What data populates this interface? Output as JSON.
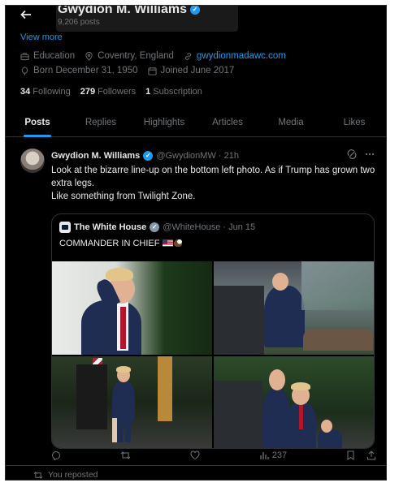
{
  "header": {
    "name": "Gwydion M. Williams",
    "posts_count": "9,206 posts",
    "view_more": "View more"
  },
  "profile_meta": {
    "category": "Education",
    "location": "Coventry, England",
    "website": "gwydionmadawc.com",
    "born": "Born December 31, 1950",
    "joined": "Joined June 2017"
  },
  "stats": {
    "following_count": "34",
    "following_label": "Following",
    "followers_count": "279",
    "followers_label": "Followers",
    "subscription_count": "1",
    "subscription_label": "Subscription"
  },
  "tabs": [
    {
      "label": "Posts",
      "active": true
    },
    {
      "label": "Replies",
      "active": false
    },
    {
      "label": "Highlights",
      "active": false
    },
    {
      "label": "Articles",
      "active": false
    },
    {
      "label": "Media",
      "active": false
    },
    {
      "label": "Likes",
      "active": false
    }
  ],
  "post": {
    "author": "Gwydion M. Williams",
    "handle": "@GwydionMW · 21h",
    "text_line1": "Look at the bizarre line-up on the bottom left photo.  As if Trump has grown two extra legs.",
    "text_line2": "Like something from Twilight Zone.",
    "quote": {
      "author": "The White House",
      "handle": "@WhiteHouse · Jun 15",
      "text": "COMMANDER IN CHIEF"
    },
    "views": "237"
  },
  "next_post": {
    "repost_label": "You reposted"
  },
  "colors": {
    "background": "#000000",
    "accent": "#1d9bf0",
    "text": "#e7e9ea",
    "muted": "#71767b"
  }
}
